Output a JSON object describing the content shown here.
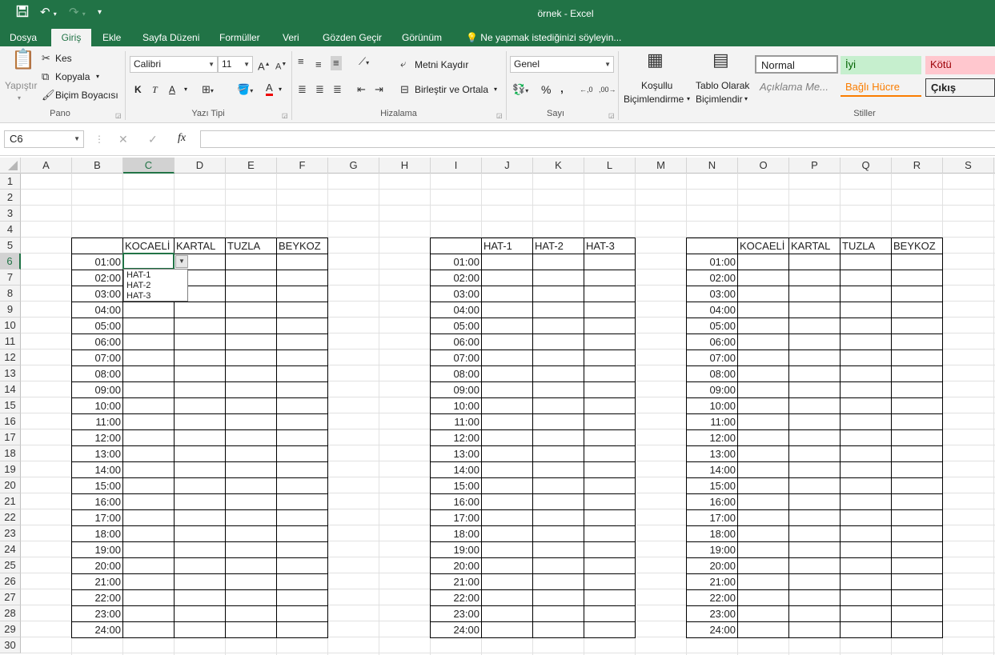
{
  "window": {
    "title": "örnek - Excel"
  },
  "tabs": [
    "Dosya",
    "Giriş",
    "Ekle",
    "Sayfa Düzeni",
    "Formüller",
    "Veri",
    "Gözden Geçir",
    "Görünüm"
  ],
  "tell_me": "Ne yapmak istediğinizi söyleyin...",
  "ribbon": {
    "clipboard": {
      "paste": "Yapıştır",
      "cut": "Kes",
      "copy": "Kopyala",
      "format_painter": "Biçim Boyacısı",
      "label": "Pano"
    },
    "font": {
      "name": "Calibri",
      "size": "11",
      "bold": "K",
      "italic": "T",
      "underline": "A",
      "label": "Yazı Tipi"
    },
    "alignment": {
      "wrap": "Metni Kaydır",
      "merge": "Birleştir ve Ortala",
      "label": "Hizalama"
    },
    "number": {
      "format": "Genel",
      "percent": "%",
      "comma": "‚",
      "label": "Sayı"
    },
    "styles": {
      "conditional": [
        "Koşullu",
        "Biçimlendirme"
      ],
      "table": [
        "Tablo Olarak",
        "Biçimlendir"
      ],
      "normal": "Normal",
      "good": "İyi",
      "bad": "Kötü",
      "note": "Açıklama Me...",
      "linked": "Bağlı Hücre",
      "output": "Çıkış",
      "label": "Stiller"
    }
  },
  "namebox": "C6",
  "fx": "fx",
  "columns": [
    "A",
    "B",
    "C",
    "D",
    "E",
    "F",
    "G",
    "H",
    "I",
    "J",
    "K",
    "L",
    "M",
    "N",
    "O",
    "P",
    "Q",
    "R",
    "S"
  ],
  "rows": [
    "1",
    "2",
    "3",
    "4",
    "5",
    "6",
    "7",
    "8",
    "9",
    "10",
    "11",
    "12",
    "13",
    "14",
    "15",
    "16",
    "17",
    "18",
    "19",
    "20",
    "21",
    "22",
    "23",
    "24",
    "25",
    "26",
    "27",
    "28",
    "29",
    "30"
  ],
  "times": [
    "01:00",
    "02:00",
    "03:00",
    "04:00",
    "05:00",
    "06:00",
    "07:00",
    "08:00",
    "09:00",
    "10:00",
    "11:00",
    "12:00",
    "13:00",
    "14:00",
    "15:00",
    "16:00",
    "17:00",
    "18:00",
    "19:00",
    "20:00",
    "21:00",
    "22:00",
    "23:00",
    "24:00"
  ],
  "table1_headers": [
    "KOCAELİ",
    "KARTAL",
    "TUZLA",
    "BEYKOZ"
  ],
  "table2_headers": [
    "HAT-1",
    "HAT-2",
    "HAT-3"
  ],
  "table3_headers": [
    "KOCAELİ",
    "KARTAL",
    "TUZLA",
    "BEYKOZ"
  ],
  "dropdown_options": [
    "HAT-1",
    "HAT-2",
    "HAT-3"
  ],
  "colors": {
    "accent": "#217346"
  }
}
